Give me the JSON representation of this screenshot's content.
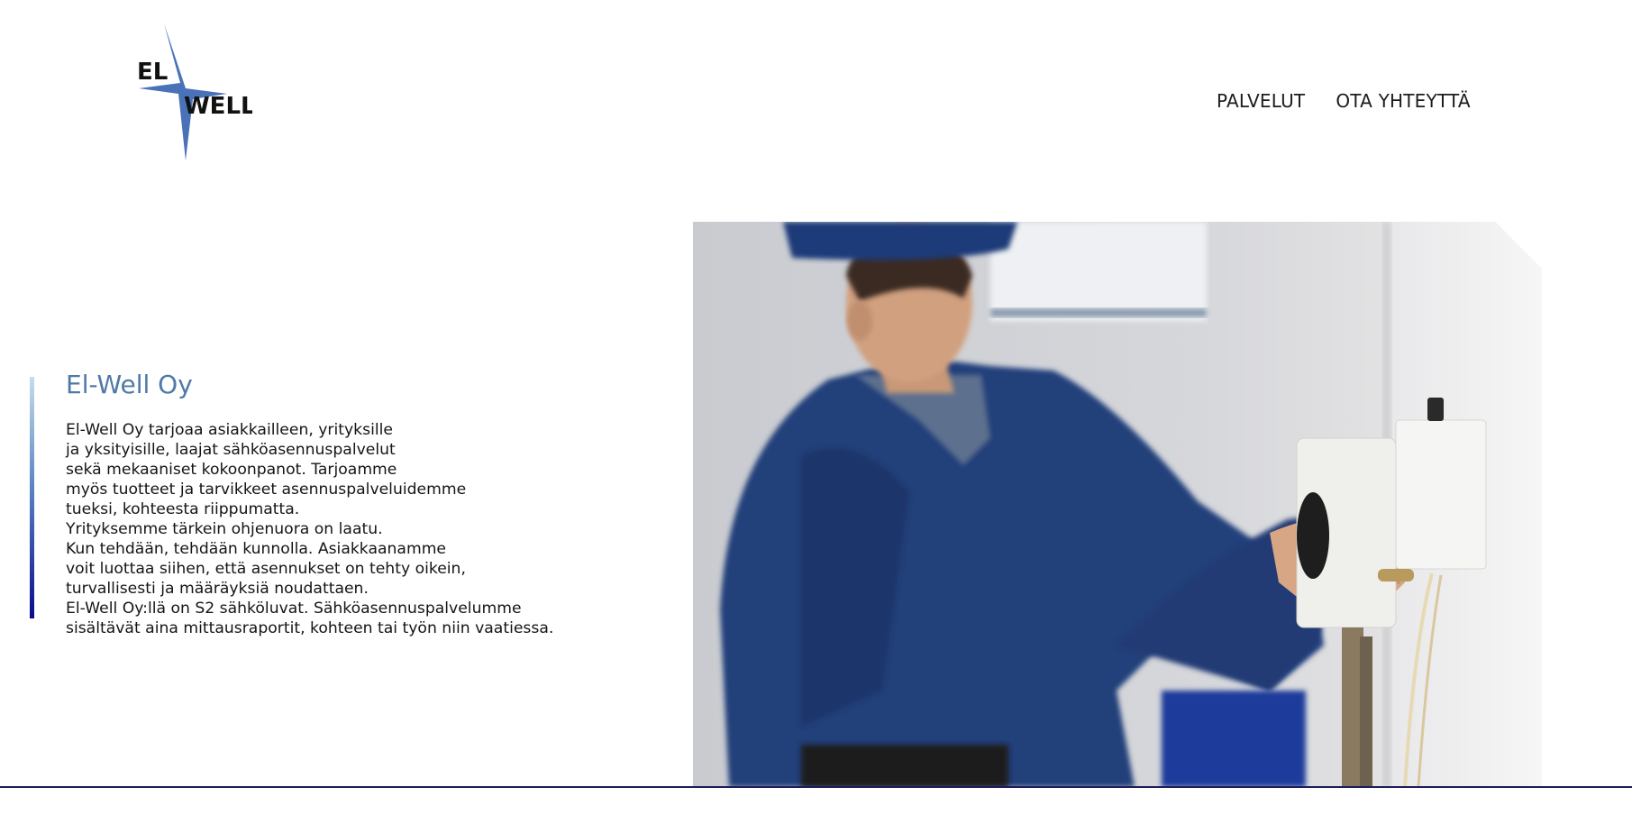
{
  "logo": {
    "line1": "EL",
    "line2": "WELL"
  },
  "nav": {
    "items": [
      "PALVELUT",
      "OTA YHTEYTTÄ"
    ]
  },
  "intro": {
    "title": "El-Well Oy",
    "lines": [
      "El-Well Oy tarjoaa asiakkailleen, yrityksille",
      "ja yksityisille, laajat sähköasennuspalvelut",
      "sekä mekaaniset kokoonpanot. Tarjoamme",
      "myös tuotteet ja tarvikkeet asennuspalveluidemme",
      "tueksi, kohteesta riippumatta.",
      "Yrityksemme tärkein ohjenuora on laatu.",
      "Kun tehdään, tehdään kunnolla. Asiakkaanamme",
      "voit luottaa siihen, että asennukset on tehty oikein,",
      "turvallisesti ja määräyksiä noudattaen.",
      "El-Well Oy:llä on S2 sähköluvat. Sähköasennuspalvelumme",
      "sisältävät aina mittausraportit, kohteen tai työn niin vaatiessa."
    ]
  },
  "colors": {
    "accent": "#4f79a6",
    "logo_blue": "#4a72b8",
    "gradient_top": "#8fb6dc",
    "gradient_bottom": "#00008b"
  },
  "hero": {
    "icon": "electrician-photo"
  }
}
